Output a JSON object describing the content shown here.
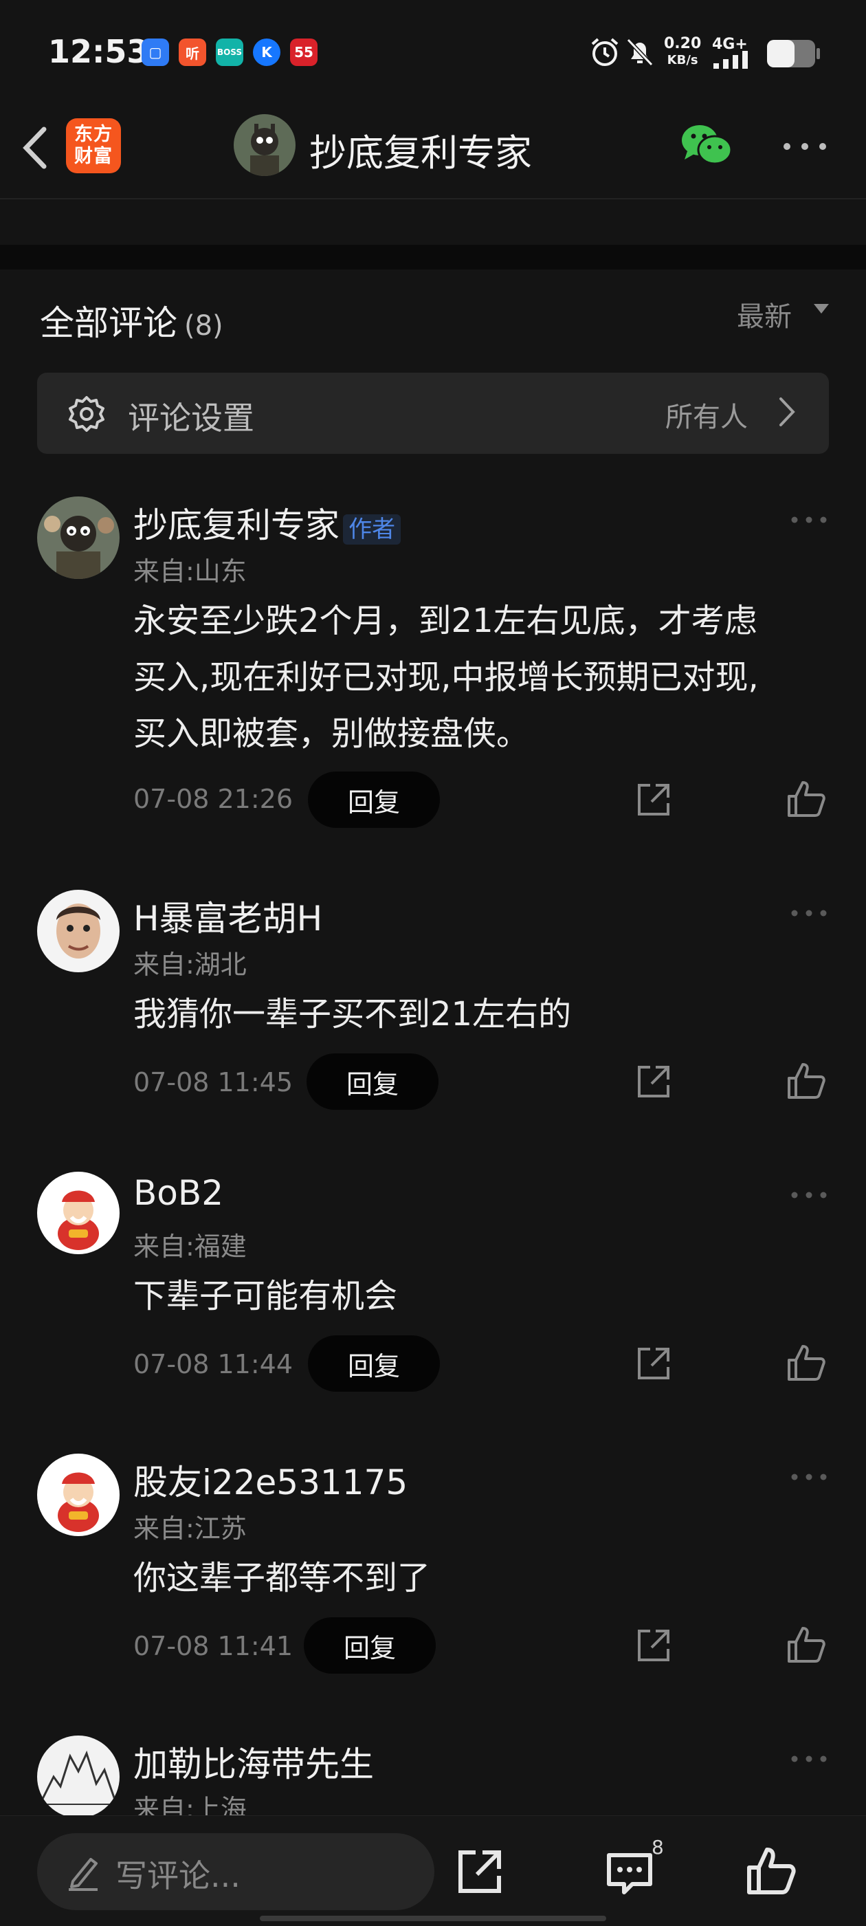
{
  "status_bar": {
    "time": "12:53",
    "notif_apps": [
      {
        "icon": "app-notif-icon-1",
        "glyph": "▢",
        "color": "#2f7bf5"
      },
      {
        "icon": "app-notif-icon-2",
        "glyph": "听",
        "color": "#f2542d"
      },
      {
        "icon": "app-notif-icon-3",
        "glyph": "BOSS",
        "color": "#12b3a8"
      },
      {
        "icon": "app-notif-icon-4",
        "glyph": "K",
        "color": "#1677ff"
      },
      {
        "icon": "app-notif-icon-5",
        "glyph": "55",
        "color": "#d9222a"
      }
    ],
    "net_speed": "0.20",
    "net_unit": "KB/s",
    "net_type": "4G+"
  },
  "header": {
    "logo_line1": "东方",
    "logo_line2": "财富",
    "title": "抄底复利专家"
  },
  "comments_header": {
    "title": "全部评论",
    "count": "(8)",
    "sort": "最新"
  },
  "settings": {
    "label": "评论设置",
    "value": "所有人"
  },
  "comments": [
    {
      "name": "抄底复利专家",
      "tag": "作者",
      "location": "来自:山东",
      "lines": [
        "永安至少跌2个月，到21左右见底，才考虑",
        "买入,现在利好已对现,中报增长预期已对现,",
        "买入即被套，别做接盘侠。"
      ],
      "time": "07-08 21:26",
      "reply": "回复"
    },
    {
      "name": "H暴富老胡H",
      "location": "来自:湖北",
      "lines": [
        "我猜你一辈子买不到21左右的"
      ],
      "time": "07-08 11:45",
      "reply": "回复"
    },
    {
      "name": "BoB2",
      "location": "来自:福建",
      "lines": [
        "下辈子可能有机会"
      ],
      "time": "07-08 11:44",
      "reply": "回复"
    },
    {
      "name": "股友i22e531175",
      "location": "来自:江苏",
      "lines": [
        "你这辈子都等不到了"
      ],
      "time": "07-08 11:41",
      "reply": "回复"
    },
    {
      "name": "加勒比海带先生",
      "location": "来自:上海"
    }
  ],
  "bottom_bar": {
    "placeholder": "写评论...",
    "comment_count": "8"
  }
}
